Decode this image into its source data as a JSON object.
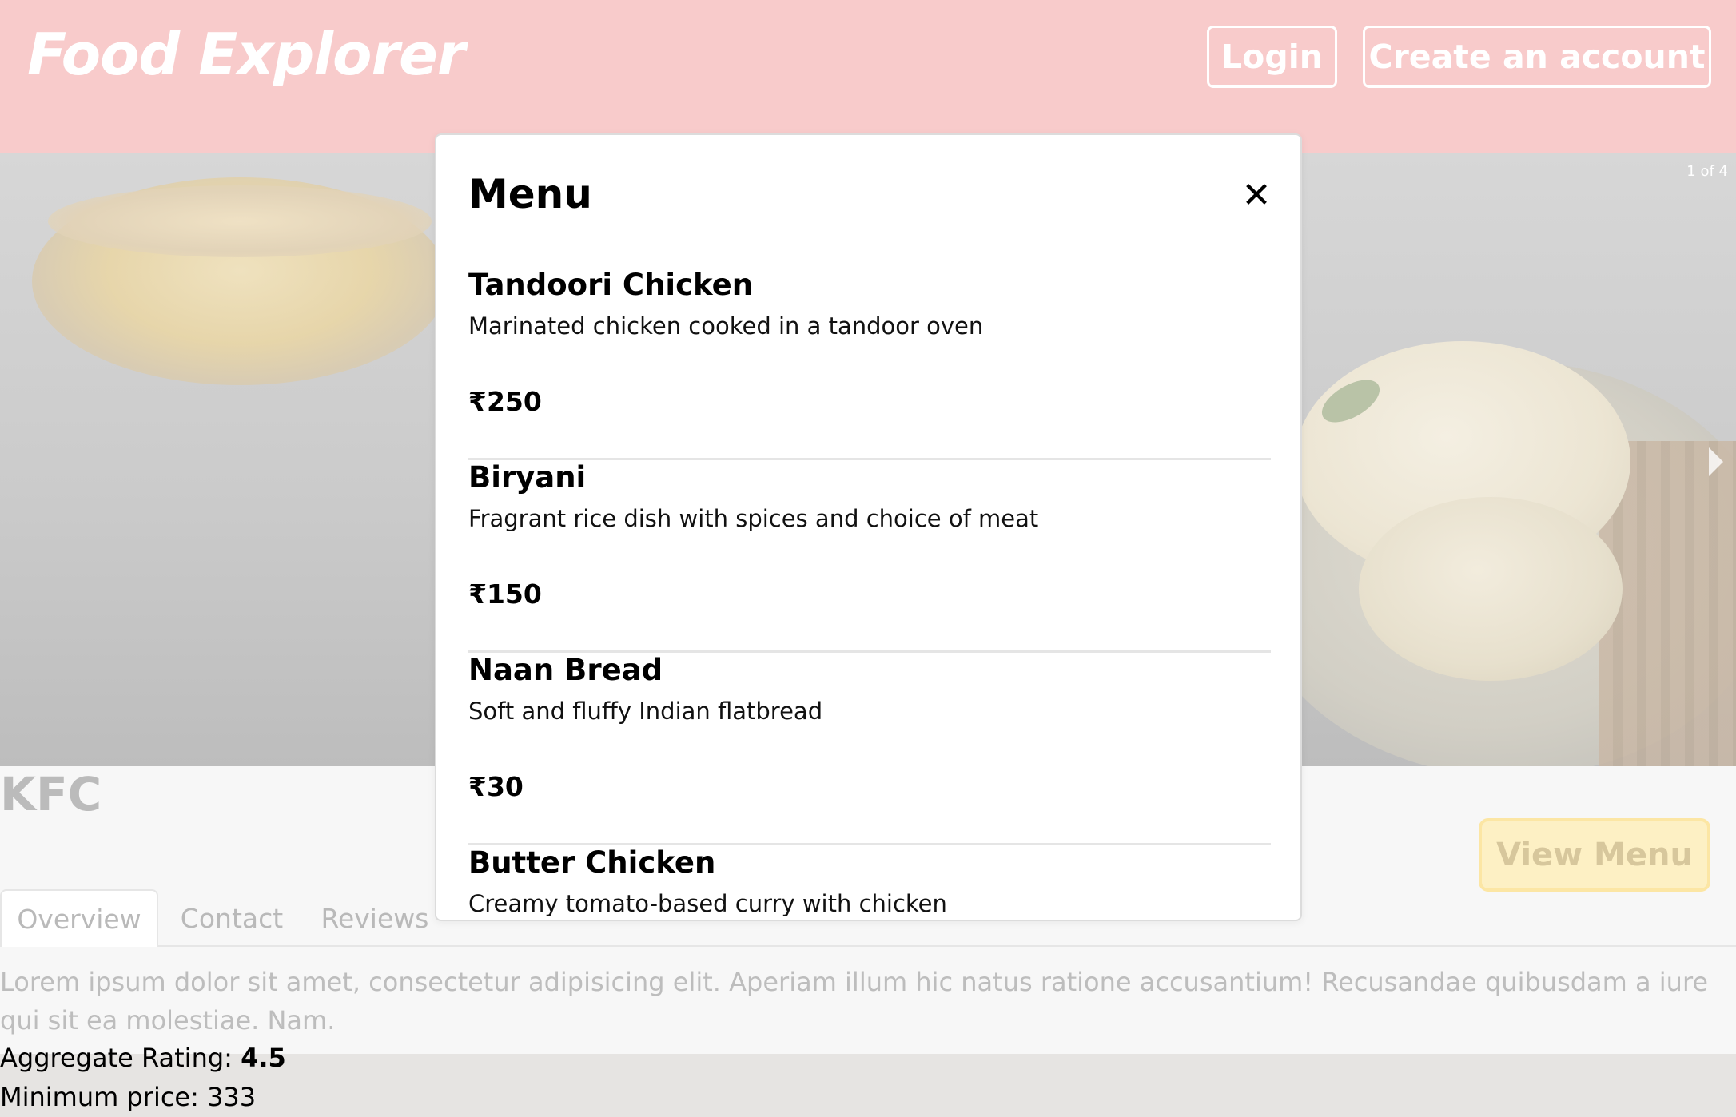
{
  "header": {
    "brand": "Food Explorer",
    "login_label": "Login",
    "create_account_label": "Create an account"
  },
  "carousel": {
    "counter": "1 of 4",
    "current_slide": 1,
    "total_slides": 4
  },
  "restaurant": {
    "name": "KFC",
    "view_menu_label": "View Menu",
    "tabs": [
      {
        "label": "Overview",
        "active": true
      },
      {
        "label": "Contact",
        "active": false
      },
      {
        "label": "Reviews",
        "active": false
      }
    ],
    "description": "Lorem ipsum dolor sit amet, consectetur adipisicing elit. Aperiam illum hic natus ratione accusantium! Recusandae quibusdam a iure qui sit ea molestiae. Nam.",
    "rating_label": "Aggregate Rating: ",
    "rating_value": "4.5",
    "min_price_label": "Minimum price: ",
    "min_price_value": "333"
  },
  "modal": {
    "title": "Menu",
    "close_icon": "close-icon",
    "items": [
      {
        "name": "Tandoori Chicken",
        "description": "Marinated chicken cooked in a tandoor oven",
        "price": "₹250"
      },
      {
        "name": "Biryani",
        "description": "Fragrant rice dish with spices and choice of meat",
        "price": "₹150"
      },
      {
        "name": "Naan Bread",
        "description": "Soft and fluffy Indian flatbread",
        "price": "₹30"
      },
      {
        "name": "Butter Chicken",
        "description": "Creamy tomato-based curry with chicken",
        "price": ""
      }
    ]
  },
  "colors": {
    "header_bg": "#f8cbcb",
    "view_menu_bg": "#fdf0c4",
    "modal_bg": "#ffffff"
  }
}
